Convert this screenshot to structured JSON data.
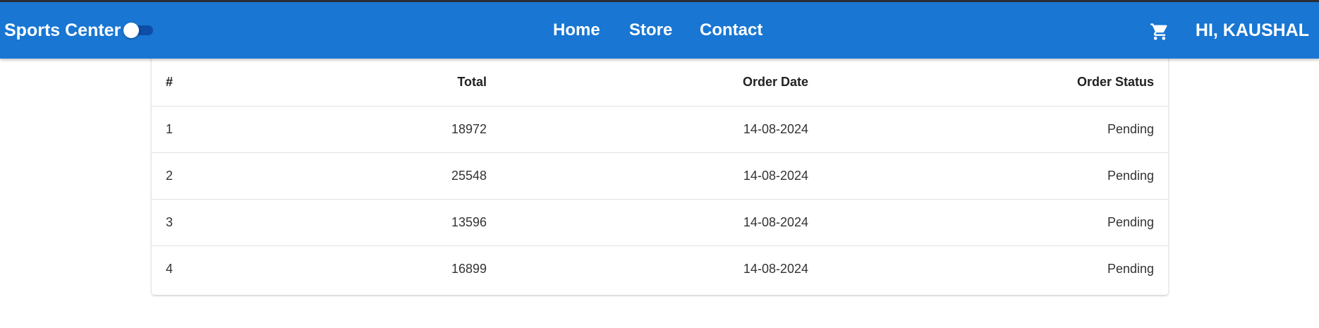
{
  "app": {
    "brand": "Sports Center",
    "theme_toggle": "off"
  },
  "nav": {
    "items": [
      {
        "label": "Home"
      },
      {
        "label": "Store"
      },
      {
        "label": "Contact"
      }
    ]
  },
  "header": {
    "cart_icon": "shopping-cart-icon",
    "greeting": "HI, KAUSHAL"
  },
  "colors": {
    "appbar": "#1976d2",
    "appbar_text": "#ffffff",
    "row_divider": "#e0e0e0"
  },
  "orders": {
    "columns": [
      "#",
      "Total",
      "Order Date",
      "Order Status"
    ],
    "rows": [
      {
        "id": "1",
        "total": "18972",
        "date": "14-08-2024",
        "status": "Pending"
      },
      {
        "id": "2",
        "total": "25548",
        "date": "14-08-2024",
        "status": "Pending"
      },
      {
        "id": "3",
        "total": "13596",
        "date": "14-08-2024",
        "status": "Pending"
      },
      {
        "id": "4",
        "total": "16899",
        "date": "14-08-2024",
        "status": "Pending"
      }
    ]
  }
}
